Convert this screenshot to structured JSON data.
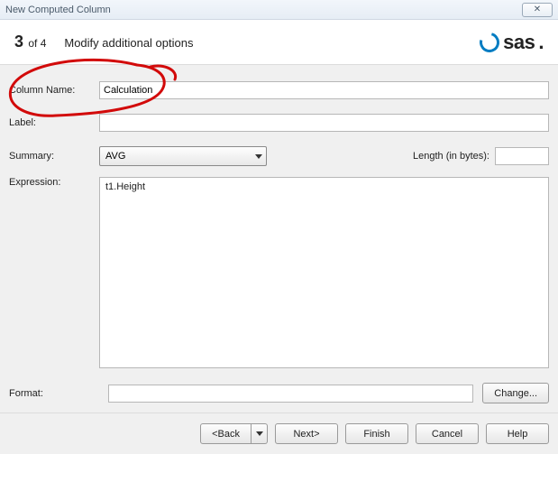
{
  "window": {
    "title": "New Computed Column",
    "close_glyph": "✕"
  },
  "header": {
    "step_num": "3",
    "step_of": " of 4",
    "title": "Modify additional options",
    "logo_text": "sas"
  },
  "form": {
    "column_name_label": "Column Name:",
    "column_name_value": "Calculation",
    "label_label": "Label:",
    "label_value": "",
    "summary_label": "Summary:",
    "summary_value": "AVG",
    "length_label": "Length (in bytes):",
    "length_value": "",
    "expression_label": "Expression:",
    "expression_value": "t1.Height",
    "format_label": "Format:",
    "format_value": "",
    "change_button": "Change..."
  },
  "footer": {
    "back": "<Back",
    "next": "Next>",
    "finish": "Finish",
    "cancel": "Cancel",
    "help": "Help"
  }
}
